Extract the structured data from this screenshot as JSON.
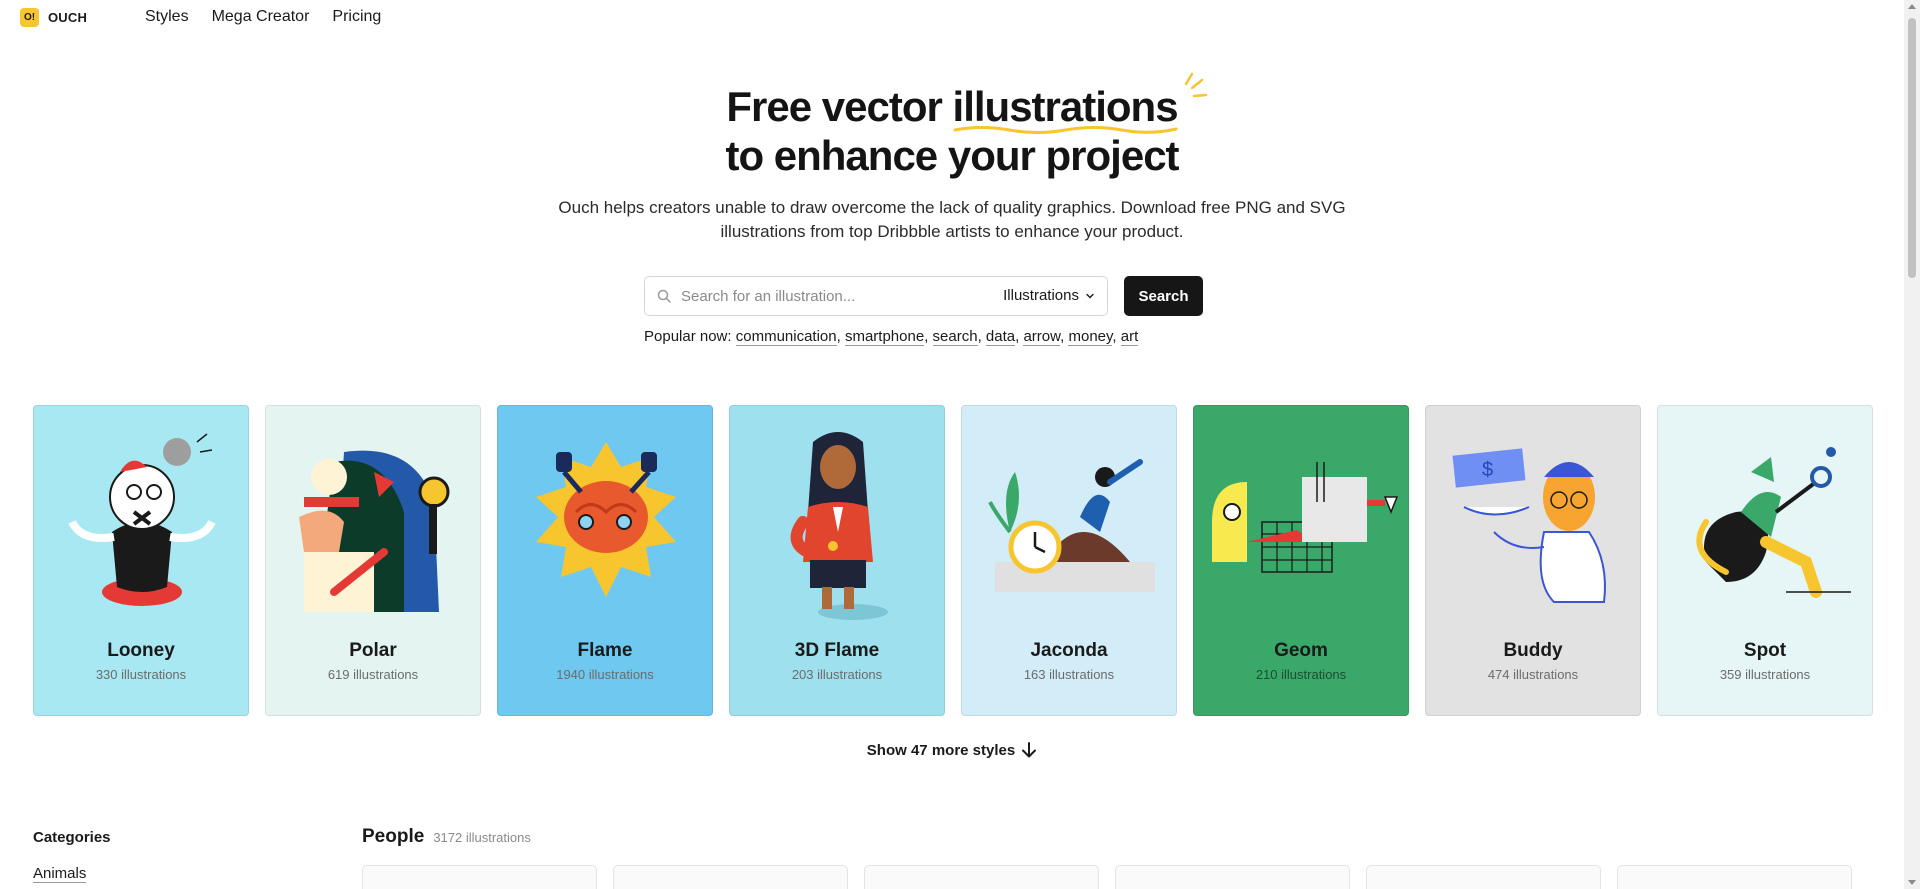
{
  "header": {
    "logo_mark": "O!",
    "logo_text": "OUCH",
    "nav": [
      "Styles",
      "Mega Creator",
      "Pricing"
    ]
  },
  "hero": {
    "title_before": "Free vector ",
    "title_highlight": "illustrations",
    "title_line2": "to enhance your project",
    "subtitle_line1": "Ouch helps creators unable to draw overcome the lack of quality graphics. Download free PNG and SVG",
    "subtitle_line2": "illustrations from top Dribbble artists to enhance your product."
  },
  "search": {
    "placeholder": "Search for an illustration...",
    "type_value": "Illustrations",
    "button_label": "Search",
    "popular_label": "Popular now:",
    "popular_tags": [
      "communication",
      "smartphone",
      "search",
      "data",
      "arrow",
      "money",
      "art"
    ]
  },
  "styles": [
    {
      "name": "Looney",
      "count": "330 illustrations",
      "bg": "#a8e8f2",
      "icon": "looney-cartoon-icon"
    },
    {
      "name": "Polar",
      "count": "619 illustrations",
      "bg": "#e4f5f1",
      "icon": "polar-chef-icon"
    },
    {
      "name": "Flame",
      "count": "1940 illustrations",
      "bg": "#6ec8f0",
      "icon": "flame-brain-icon"
    },
    {
      "name": "3D Flame",
      "count": "203 illustrations",
      "bg": "#9ee0ee",
      "icon": "3d-woman-icon"
    },
    {
      "name": "Jaconda",
      "count": "163 illustrations",
      "bg": "#d2ecf8",
      "icon": "jaconda-clock-icon"
    },
    {
      "name": "Geom",
      "count": "210 illustrations",
      "bg": "#3aa869",
      "icon": "geom-shapes-icon"
    },
    {
      "name": "Buddy",
      "count": "474 illustrations",
      "bg": "#e2e2e2",
      "icon": "buddy-money-icon"
    },
    {
      "name": "Spot",
      "count": "359 illustrations",
      "bg": "#e6f5f5",
      "icon": "spot-runner-icon"
    }
  ],
  "show_more": "Show 47 more styles",
  "categories": {
    "title": "Categories",
    "items": [
      "Animals"
    ]
  },
  "section": {
    "title": "People",
    "count": "3172 illustrations"
  },
  "colors": {
    "accent_yellow": "#f7c52e",
    "button_dark": "#161616"
  }
}
